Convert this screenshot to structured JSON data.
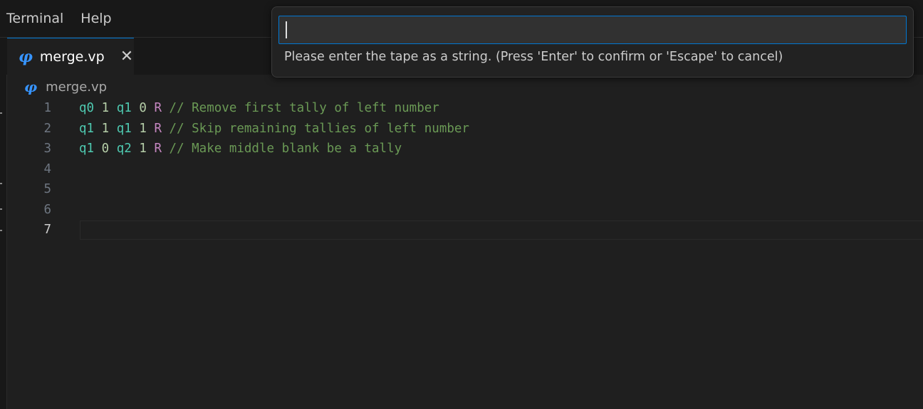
{
  "menubar": {
    "items": [
      "Terminal",
      "Help"
    ]
  },
  "tab": {
    "label": "merge.vp",
    "icon": "vp-file-icon",
    "close_icon": "✕"
  },
  "breadcrumb": {
    "label": "merge.vp"
  },
  "editor": {
    "lines": [
      {
        "number": "1",
        "tokens": [
          [
            "q0",
            "state"
          ],
          [
            " ",
            "space"
          ],
          [
            "1",
            "num"
          ],
          [
            " ",
            "space"
          ],
          [
            "q1",
            "state"
          ],
          [
            " ",
            "space"
          ],
          [
            "0",
            "num"
          ],
          [
            " ",
            "space"
          ],
          [
            "R",
            "dir"
          ],
          [
            " ",
            "space"
          ],
          [
            "// Remove first tally of left number",
            "comment"
          ]
        ]
      },
      {
        "number": "2",
        "tokens": [
          [
            "q1",
            "state"
          ],
          [
            " ",
            "space"
          ],
          [
            "1",
            "num"
          ],
          [
            " ",
            "space"
          ],
          [
            "q1",
            "state"
          ],
          [
            " ",
            "space"
          ],
          [
            "1",
            "num"
          ],
          [
            " ",
            "space"
          ],
          [
            "R",
            "dir"
          ],
          [
            " ",
            "space"
          ],
          [
            "// Skip remaining tallies of left number",
            "comment"
          ]
        ]
      },
      {
        "number": "3",
        "tokens": [
          [
            "q1",
            "state"
          ],
          [
            " ",
            "space"
          ],
          [
            "0",
            "num"
          ],
          [
            " ",
            "space"
          ],
          [
            "q2",
            "state"
          ],
          [
            " ",
            "space"
          ],
          [
            "1",
            "num"
          ],
          [
            " ",
            "space"
          ],
          [
            "R",
            "dir"
          ],
          [
            " ",
            "space"
          ],
          [
            "// Make middle blank be a tally",
            "comment"
          ]
        ]
      },
      {
        "number": "4",
        "tokens": []
      },
      {
        "number": "5",
        "tokens": []
      },
      {
        "number": "6",
        "tokens": []
      },
      {
        "number": "7",
        "tokens": [],
        "current": true
      }
    ]
  },
  "quick_input": {
    "value": "",
    "message": "Please enter the tape as a string. (Press 'Enter' to confirm or 'Escape' to cancel)"
  },
  "colors": {
    "accent": "#0078d4",
    "file_icon": "#3794ff",
    "state": "#4ec9b0",
    "number": "#b5cea8",
    "direction": "#c586c0",
    "comment": "#6a9955"
  }
}
